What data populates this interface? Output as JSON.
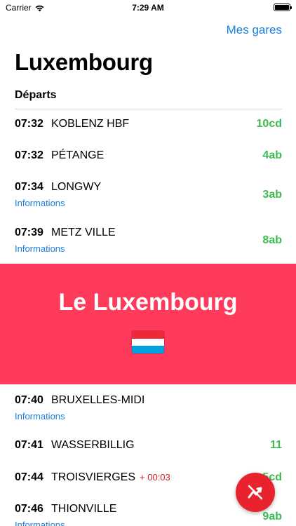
{
  "status_bar": {
    "carrier": "Carrier",
    "time": "7:29 AM"
  },
  "nav": {
    "right_link": "Mes gares"
  },
  "page_title": "Luxembourg",
  "section_title": "Départs",
  "departures": [
    {
      "time": "07:32",
      "destination": "KOBLENZ HBF",
      "track": "10cd",
      "info": "",
      "delay": ""
    },
    {
      "time": "07:32",
      "destination": "PÉTANGE",
      "track": "4ab",
      "info": "",
      "delay": ""
    },
    {
      "time": "07:34",
      "destination": "LONGWY",
      "track": "3ab",
      "info": "Informations",
      "delay": ""
    },
    {
      "time": "07:39",
      "destination": "METZ VILLE",
      "track": "8ab",
      "info": "Informations",
      "delay": ""
    },
    {
      "time": "07:40",
      "destination": "BRUXELLES-MIDI",
      "track": "",
      "info": "Informations",
      "delay": ""
    },
    {
      "time": "07:41",
      "destination": "WASSERBILLIG",
      "track": "11",
      "info": "",
      "delay": ""
    },
    {
      "time": "07:44",
      "destination": "TROISVIERGES",
      "track": "5cd",
      "info": "",
      "delay": "+ 00:03"
    },
    {
      "time": "07:46",
      "destination": "THIONVILLE",
      "track": "9ab",
      "info": "Informations",
      "delay": ""
    }
  ],
  "banner": {
    "title": "Le Luxembourg",
    "flag": "luxembourg-flag-icon"
  },
  "colors": {
    "accent_blue": "#1a7fe0",
    "track_green": "#3cbc4f",
    "banner_pink": "#ff3b5c",
    "delay_red": "#d32020",
    "fab_red": "#e8232e",
    "flag_red": "#ed2939",
    "flag_white": "#ffffff",
    "flag_blue": "#00a1de"
  },
  "fab": {
    "icon": "no-train-icon"
  }
}
